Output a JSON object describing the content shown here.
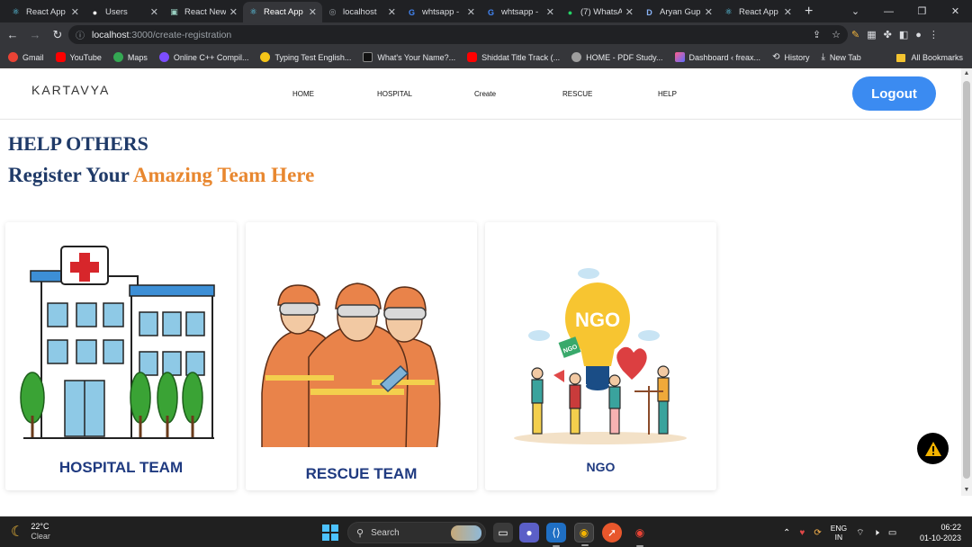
{
  "browser": {
    "tabs": [
      {
        "label": "React App",
        "icon": "react-icon",
        "active": false
      },
      {
        "label": "Users",
        "icon": "github-icon",
        "active": false
      },
      {
        "label": "React New",
        "icon": "codesandbox-icon",
        "active": false
      },
      {
        "label": "React App",
        "icon": "react-icon",
        "active": true
      },
      {
        "label": "localhost",
        "icon": "globe-icon",
        "active": false
      },
      {
        "label": "whtsapp -",
        "icon": "google-icon",
        "active": false
      },
      {
        "label": "whtsapp -",
        "icon": "google-icon",
        "active": false
      },
      {
        "label": "(7) WhatsA",
        "icon": "whatsapp-icon",
        "active": false
      },
      {
        "label": "Aryan Gup",
        "icon": "d-icon",
        "active": false
      },
      {
        "label": "React App",
        "icon": "react-icon",
        "active": false
      }
    ],
    "url_host": "localhost",
    "url_path": ":3000/create-registration",
    "bookmarks": [
      {
        "label": "Gmail",
        "color": "#ea4335"
      },
      {
        "label": "YouTube",
        "color": "#ff0000"
      },
      {
        "label": "Maps",
        "color": "#34a853"
      },
      {
        "label": "Online C++ Compil...",
        "color": "#7c4dff"
      },
      {
        "label": "Typing Test English...",
        "color": "#f5c518"
      },
      {
        "label": "What's Your Name?...",
        "color": "#111111"
      },
      {
        "label": "Shiddat Title Track (...",
        "color": "#ff0000"
      },
      {
        "label": "HOME - PDF Study...",
        "color": "#9e9e9e"
      },
      {
        "label": "Dashboard ‹ freax...",
        "color": "#ff5e8a"
      },
      {
        "label": "History",
        "color": "#dadce0"
      },
      {
        "label": "New Tab",
        "color": "#dadce0"
      }
    ],
    "all_bookmarks": "All Bookmarks"
  },
  "site": {
    "logo": "KARTAVYA",
    "nav": [
      "HOME",
      "HOSPITAL",
      "Create",
      "RESCUE",
      "HELP"
    ],
    "logout_label": "Logout",
    "heading": "HELP OTHERS",
    "subheading_start": "Register Your ",
    "subheading_accent": "Amazing Team Here",
    "cards": [
      {
        "title": "HOSPITAL TEAM"
      },
      {
        "title": "RESCUE TEAM"
      },
      {
        "title": "NGO"
      }
    ],
    "ngo_bulb_text": "NGO",
    "ngo_flag_text": "NGO"
  },
  "taskbar": {
    "temperature": "22°C",
    "condition": "Clear",
    "search_placeholder": "Search",
    "lang_top": "ENG",
    "lang_bottom": "IN",
    "time": "06:22",
    "date": "01-10-2023"
  },
  "colors": {
    "navy": "#1f3a68",
    "orange": "#e8872f",
    "logout_blue": "#3b8bf1"
  }
}
